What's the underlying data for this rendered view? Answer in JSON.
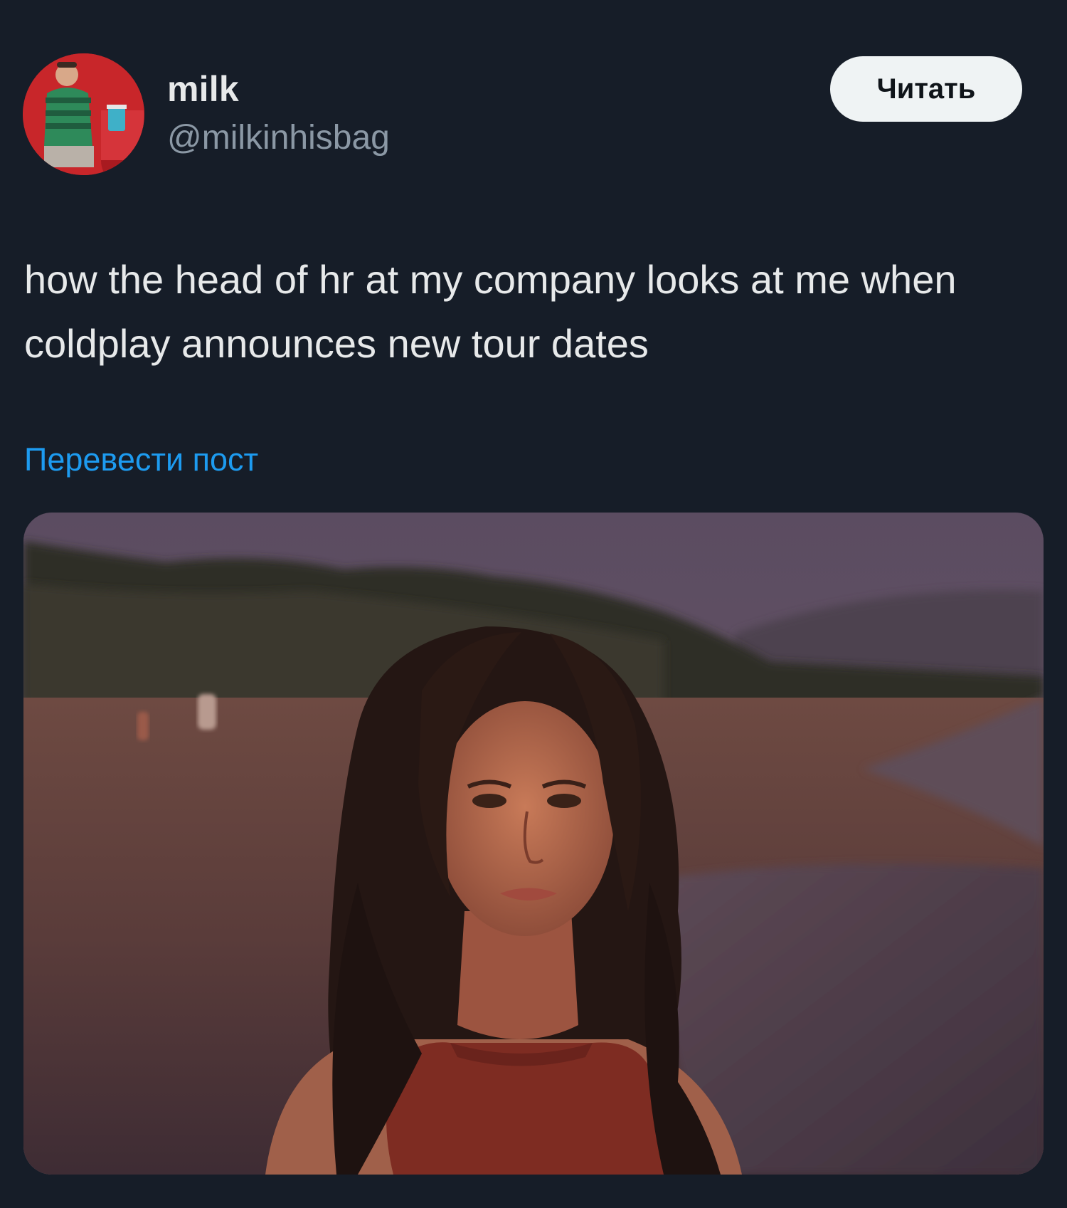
{
  "post": {
    "author": {
      "display_name": "milk",
      "handle": "@milkinhisbag",
      "avatar_icon": "profile-photo"
    },
    "follow_button_label": "Читать",
    "text": "how the head of hr at my company looks at me when coldplay announces new tour dates",
    "translate_label": "Перевести пост",
    "media": {
      "kind": "photo"
    }
  },
  "colors": {
    "background": "#161d28",
    "primary_text": "#e7e9ea",
    "secondary_text": "#8b98a5",
    "link": "#1d9bf0",
    "button_bg": "#eff3f4"
  }
}
